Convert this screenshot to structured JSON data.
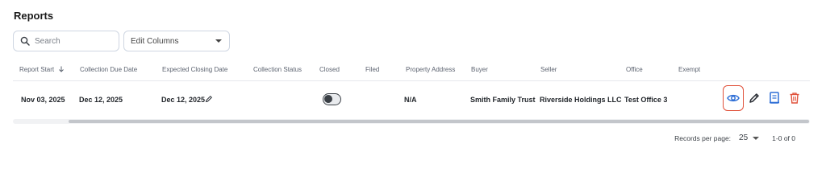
{
  "page": {
    "title": "Reports"
  },
  "toolbar": {
    "search_placeholder": "Search",
    "columns_select": "Edit Columns"
  },
  "table": {
    "columns": [
      "Report Start",
      "Collection Due Date",
      "Expected Closing Date",
      "Collection Status",
      "Closed",
      "Filed",
      "Property Address",
      "Buyer",
      "Seller",
      "Office",
      "Exempt"
    ],
    "sort_icon": "arrow-down-icon",
    "rows": [
      {
        "report_start": "Nov 03, 2025",
        "collection_due_date": "Dec 12, 2025",
        "expected_closing_date": "Dec 12, 2025",
        "collection_status": "",
        "closed": false,
        "filed": "",
        "property_address": "N/A",
        "buyer": "Smith Family Trust",
        "seller": "Riverside Holdings LLC",
        "office": "Test Office 3",
        "exempt": ""
      }
    ],
    "actions": [
      {
        "name": "view",
        "icon": "eye-icon",
        "color": "#2f6fd6",
        "highlight": "#e0513a"
      },
      {
        "name": "edit",
        "icon": "pencil-icon",
        "color": "#2b2f36"
      },
      {
        "name": "report",
        "icon": "document-icon",
        "color": "#2f6fd6"
      },
      {
        "name": "delete",
        "icon": "trash-icon",
        "color": "#e0513a"
      }
    ]
  },
  "pagination": {
    "records_per_page_label": "Records per page:",
    "page_size": "25",
    "range": "1-0 of 0"
  }
}
